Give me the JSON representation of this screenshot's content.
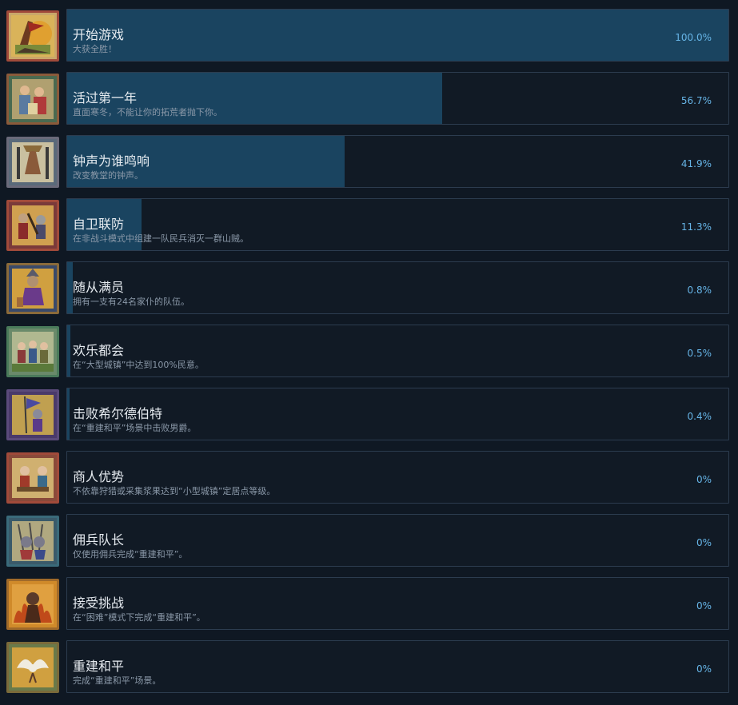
{
  "achievements": [
    {
      "title": "开始游戏",
      "desc": "大获全胜！",
      "percent_label": "100.0%",
      "progress": 1.0,
      "icon": "victory-banner-icon"
    },
    {
      "title": "活过第一年",
      "desc": "直面寒冬，不能让你的拓荒者抛下你。",
      "percent_label": "56.7%",
      "progress": 0.567,
      "icon": "settlers-family-icon"
    },
    {
      "title": "钟声为谁鸣响",
      "desc": "改变教堂的钟声。",
      "percent_label": "41.9%",
      "progress": 0.419,
      "icon": "church-bell-icon"
    },
    {
      "title": "自卫联防",
      "desc": "在非战斗模式中组建一队民兵消灭一群山贼。",
      "percent_label": "11.3%",
      "progress": 0.113,
      "icon": "militia-battle-icon"
    },
    {
      "title": "随从满员",
      "desc": "拥有一支有24名家仆的队伍。",
      "percent_label": "0.8%",
      "progress": 0.008,
      "icon": "retinue-lord-icon"
    },
    {
      "title": "欢乐都会",
      "desc": "在“大型城镇”中达到100%民意。",
      "percent_label": "0.5%",
      "progress": 0.005,
      "icon": "dancing-villagers-icon"
    },
    {
      "title": "击败希尔德伯特",
      "desc": "在“重建和平”场景中击败男爵。",
      "percent_label": "0.4%",
      "progress": 0.004,
      "icon": "baron-battle-icon"
    },
    {
      "title": "商人优势",
      "desc": "不依靠狩猎或采集浆果达到“小型城镇”定居点等级。",
      "percent_label": "0%",
      "progress": 0,
      "icon": "merchant-trade-icon"
    },
    {
      "title": "佣兵队长",
      "desc": "仅使用佣兵完成“重建和平”。",
      "percent_label": "0%",
      "progress": 0,
      "icon": "mercenary-captain-icon"
    },
    {
      "title": "接受挑战",
      "desc": "在“困难”模式下完成“重建和平”。",
      "percent_label": "0%",
      "progress": 0,
      "icon": "beast-fire-icon"
    },
    {
      "title": "重建和平",
      "desc": "完成“重建和平”场景。",
      "percent_label": "0%",
      "progress": 0,
      "icon": "peace-dove-icon"
    }
  ],
  "colors": {
    "background": "#0f1823",
    "card": "#111a25",
    "progress_fill": "#1a4460",
    "percent_text": "#66b4e6",
    "title_text": "#e6ebf0",
    "desc_text": "#8a98a8"
  }
}
